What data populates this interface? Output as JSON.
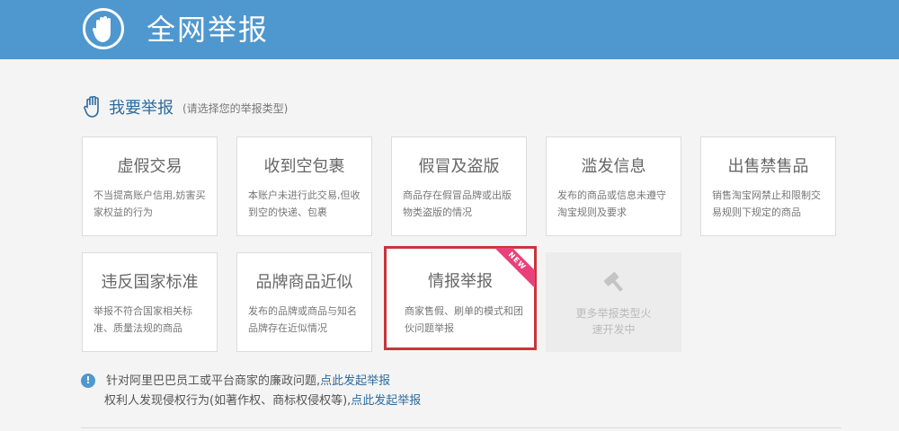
{
  "header": {
    "title": "全网举报",
    "logo_icon": "hand-icon"
  },
  "section": {
    "title": "我要举报",
    "hint": "(请选择您的举报类型)"
  },
  "cards": [
    {
      "title": "虚假交易",
      "desc": "不当提高账户信用,妨害买家权益的行为"
    },
    {
      "title": "收到空包裹",
      "desc": "本账户未进行此交易,但收到空的快递、包裹"
    },
    {
      "title": "假冒及盗版",
      "desc": "商品存在假冒品牌或出版物类盗版的情况"
    },
    {
      "title": "滥发信息",
      "desc": "发布的商品或信息未遵守淘宝规则及要求"
    },
    {
      "title": "出售禁售品",
      "desc": "销售淘宝网禁止和限制交易规则下规定的商品"
    },
    {
      "title": "违反国家标准",
      "desc": "举报不符合国家相关标准、质量法规的商品"
    },
    {
      "title": "品牌商品近似",
      "desc": "发布的品牌或商品与知名品牌存在近似情况"
    },
    {
      "title": "情报举报",
      "desc": "商家售假、刷单的模式和团伙问题举报",
      "badge": "NEW"
    }
  ],
  "more": {
    "text": "更多举报类型火速开发中",
    "icon": "hammer-icon"
  },
  "notice": {
    "line1_text": "针对阿里巴巴员工或平台商家的廉政问题,",
    "line1_link": "点此发起举报",
    "line2_text": "权利人发现侵权行为(如著作权、商标权侵权等),",
    "line2_link": "点此发起举报"
  },
  "colors": {
    "header": "#4f97cf",
    "highlight": "#c9353a",
    "badge": "#e8417a",
    "link": "#2d6b9c"
  }
}
